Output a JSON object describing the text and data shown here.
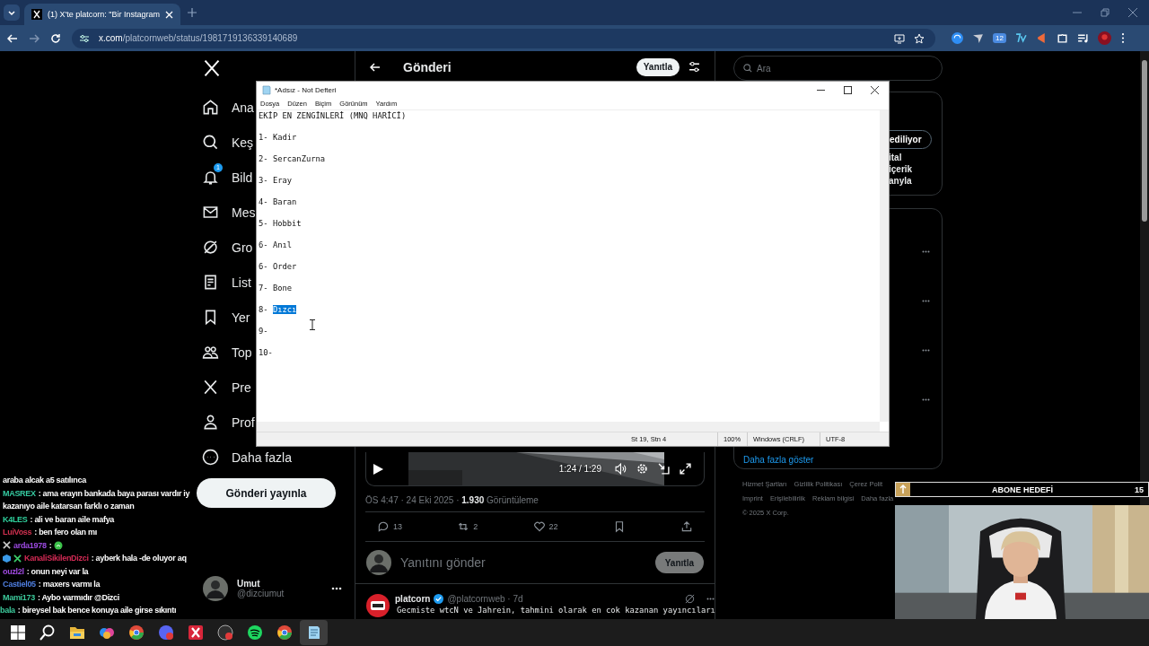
{
  "browser": {
    "tab_title": "(1) X'te platcorn: \"Bir Instagram",
    "url_host": "x.com",
    "url_path": "/platcornweb/status/1981719136339140689",
    "extension_badge": "12"
  },
  "x_nav": {
    "items": [
      {
        "kind": "home",
        "label": "Ana"
      },
      {
        "kind": "search",
        "label": "Keş"
      },
      {
        "kind": "bell",
        "label": "Bild",
        "badge": "1"
      },
      {
        "kind": "mail",
        "label": "Mes"
      },
      {
        "kind": "grok",
        "label": "Gro"
      },
      {
        "kind": "list",
        "label": "List"
      },
      {
        "kind": "bookmark",
        "label": "Yer"
      },
      {
        "kind": "people",
        "label": "Top"
      },
      {
        "kind": "x",
        "label": "Pre"
      },
      {
        "kind": "person",
        "label": "Prof"
      },
      {
        "kind": "more",
        "label": "Daha fazla"
      }
    ],
    "post_button": "Gönderi yayınla",
    "account": {
      "name": "Umut",
      "handle": "@dizciumut"
    }
  },
  "post": {
    "header": "Gönderi",
    "reply_button": "Yanıtla",
    "video_time": "1:24 / 1:29",
    "meta": "ÖS 4:47 · 24 Eki 2025 · ",
    "views": "1.930",
    "views_label": "Görüntüleme",
    "actions": [
      {
        "kind": "reply",
        "count": "13"
      },
      {
        "kind": "repost",
        "count": "2"
      },
      {
        "kind": "like",
        "count": "22"
      },
      {
        "kind": "bookmark"
      },
      {
        "kind": "share"
      }
    ],
    "reply_box": {
      "placeholder": "Yanıtını gönder",
      "button": "Yanıtla"
    }
  },
  "next_post": {
    "name": "platcorn",
    "verified": true,
    "handle": "@platcornweb · 7d",
    "text": "Gecmiste wtcN ve Jahrein, tahmini olarak en cok kazanan yayıncıları"
  },
  "right": {
    "search": {
      "placeholder": "Ara"
    },
    "card_button": "ediliyor",
    "card_lines": [
      "ital",
      "içerik",
      "anyla"
    ],
    "show_more": "Daha fazla göster",
    "footer_rows": [
      [
        "Hizmet Şartları",
        "Gizlilik Politikası",
        "Çerez Polit"
      ],
      [
        "Imprint",
        "Erişilebilirlik",
        "Reklam bilgisi",
        "Daha fazla"
      ]
    ],
    "copyright": "© 2025 X Corp."
  },
  "notepad": {
    "title": "*Adsız - Not Defteri",
    "menu": [
      "Dosya",
      "Düzen",
      "Biçim",
      "Görünüm",
      "Yardım"
    ],
    "lines": [
      {
        "text": "EKİP EN ZENGİNLERİ (MNQ HARİCİ)"
      },
      {
        "text": "1- Kadir"
      },
      {
        "text": "2- SercanZurna"
      },
      {
        "text": "3- Eray"
      },
      {
        "text": "4- Baran"
      },
      {
        "text": "5- Hobbit"
      },
      {
        "text": "6- Anıl"
      },
      {
        "text": "6- Order"
      },
      {
        "text": "7- Bone"
      },
      {
        "text": "8- ",
        "selection": "Dızcı"
      },
      {
        "text": "9-"
      },
      {
        "text": "10-"
      }
    ],
    "status": [
      "St 19, Stn 4",
      "100%",
      "Windows (CRLF)",
      "UTF-8"
    ]
  },
  "chat": [
    {
      "kind": "continuation",
      "text": "araba alcak a5 satılınca"
    },
    {
      "kind": "message",
      "user": "MASREX",
      "color": "#35c9a0",
      "text": ": ama erayın bankada baya parası vardır iy"
    },
    {
      "kind": "continuation",
      "text": "kazanıyo aile katarsan farklı o zaman"
    },
    {
      "kind": "message",
      "user": "K4LES",
      "color": "#2fcf9c",
      "text": ": ali ve baran aile mafya"
    },
    {
      "kind": "message",
      "user": "LuiVoss",
      "color": "#d0304f",
      "text": ": ben fero olan mı"
    },
    {
      "kind": "message",
      "user": "arda1978",
      "color": "#9b4ae0",
      "badges": [
        {
          "kind": "cross"
        }
      ],
      "text": ":",
      "emote": true
    },
    {
      "kind": "message",
      "user": "KanaliSikilenDizci",
      "color": "#d42a55",
      "badges": [
        {
          "kind": "cube"
        },
        {
          "kind": "green-cross"
        }
      ],
      "text": ": ayberk hala -de oluyor aq"
    },
    {
      "kind": "message",
      "user": "ouzl2l",
      "color": "#a04ae0",
      "text": ": onun neyi var la"
    },
    {
      "kind": "message",
      "user": "Castiel05",
      "color": "#4f7fe0",
      "text": ": maxers varmı la"
    },
    {
      "kind": "message",
      "user": "Mami173",
      "color": "#3cc99a",
      "text": ": Aybo varmıdır @Dizci"
    },
    {
      "kind": "message",
      "user": "bala",
      "color": "#3cc99b",
      "text": ": bireysel bak bence konuya aile girse sıkıntı"
    }
  ],
  "sub_goal": {
    "label": "ABONE HEDEFİ",
    "count": "15"
  },
  "taskbar": [
    {
      "kind": "start",
      "selected": false
    },
    {
      "kind": "search",
      "selected": false
    },
    {
      "kind": "folder",
      "selected": false
    },
    {
      "kind": "swirl",
      "selected": false
    },
    {
      "kind": "segmented",
      "selected": false
    },
    {
      "kind": "disc",
      "selected": false
    },
    {
      "kind": "crosstile",
      "selected": false
    },
    {
      "kind": "ring",
      "selected": false
    },
    {
      "kind": "wave",
      "selected": false
    },
    {
      "kind": "segmented",
      "selected": false
    },
    {
      "kind": "notepad",
      "selected": true
    }
  ]
}
